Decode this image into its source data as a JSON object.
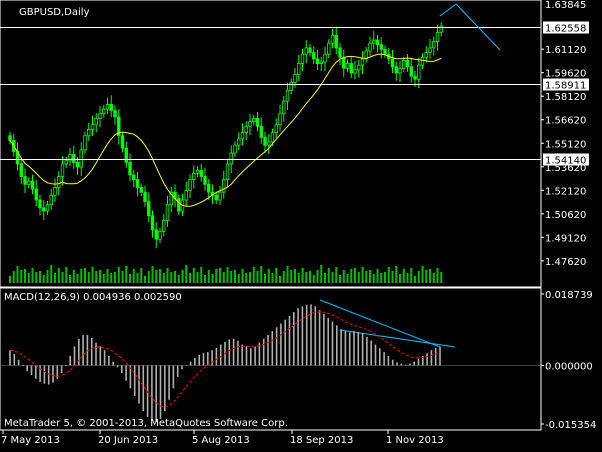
{
  "chart": {
    "symbol_label": "GBPUSD,Daily",
    "macd_label": "MACD(12,26,9) 0.004936 0.002590",
    "copyright": "MetaTrader 5, © 2001-2013, MetaQuotes Software Corp.",
    "price_axis": {
      "top_label": "1.63845",
      "labels": [
        "1.61120",
        "1.59620",
        "1.58120",
        "1.56620",
        "1.55120",
        "1.53620",
        "1.52120",
        "1.50620",
        "1.49120",
        "1.47620"
      ],
      "range": [
        1.464,
        1.64
      ]
    },
    "hlines": [
      {
        "price": "1.62558",
        "value": 1.62558,
        "boxed": true
      },
      {
        "price": "1.58911",
        "value": 1.58911,
        "boxed": true
      },
      {
        "price": "1.54140",
        "value": 1.5414,
        "boxed": true
      }
    ],
    "macd_axis": {
      "labels": [
        "0.018739",
        "0.000000",
        "-0.015354"
      ],
      "range": [
        -0.015354,
        0.018739
      ]
    },
    "date_labels": [
      "7 May 2013",
      "20 Jun 2013",
      "5 Aug 2013",
      "18 Sep 2013",
      "1 Nov 2013"
    ],
    "colors": {
      "background": "#000000",
      "grid": "#ffffff",
      "bull": "#00ff00",
      "bear": "#00ff00",
      "ma": "#ffff00",
      "trendline": "#00bfff",
      "histogram": "#b0b0b0",
      "signal": "#ff0000",
      "volume": "#00c000"
    }
  },
  "chart_data": {
    "type": "candlestick",
    "title": "GBPUSD,Daily",
    "indicators": [
      "Moving Average",
      "Volume",
      "MACD(12,26,9)"
    ],
    "ylim": [
      1.464,
      1.64
    ],
    "macd_ylim": [
      -0.015354,
      0.018739
    ],
    "close": [
      1.553,
      1.546,
      1.538,
      1.53,
      1.525,
      1.527,
      1.522,
      1.515,
      1.51,
      1.508,
      1.512,
      1.518,
      1.523,
      1.53,
      1.538,
      1.54,
      1.544,
      1.539,
      1.536,
      1.547,
      1.556,
      1.56,
      1.563,
      1.567,
      1.57,
      1.573,
      1.576,
      1.572,
      1.568,
      1.556,
      1.548,
      1.539,
      1.531,
      1.528,
      1.523,
      1.52,
      1.514,
      1.505,
      1.496,
      1.49,
      1.495,
      1.502,
      1.512,
      1.52,
      1.516,
      1.508,
      1.515,
      1.521,
      1.528,
      1.532,
      1.534,
      1.53,
      1.525,
      1.52,
      1.518,
      1.515,
      1.52,
      1.528,
      1.538,
      1.545,
      1.55,
      1.554,
      1.558,
      1.562,
      1.565,
      1.567,
      1.562,
      1.555,
      1.55,
      1.552,
      1.558,
      1.563,
      1.57,
      1.578,
      1.585,
      1.59,
      1.595,
      1.602,
      1.608,
      1.612,
      1.609,
      1.605,
      1.602,
      1.603,
      1.608,
      1.615,
      1.62,
      1.612,
      1.606,
      1.599,
      1.602,
      1.596,
      1.598,
      1.601,
      1.605,
      1.61,
      1.615,
      1.617,
      1.614,
      1.611,
      1.608,
      1.605,
      1.6,
      1.596,
      1.599,
      1.604,
      1.6,
      1.594,
      1.592,
      1.601,
      1.606,
      1.609,
      1.612,
      1.616,
      1.622,
      1.626
    ],
    "macd_histogram": [
      0.004,
      0.003,
      0.0015,
      0.0,
      -0.0015,
      -0.0025,
      -0.0035,
      -0.0043,
      -0.0048,
      -0.005,
      -0.0045,
      -0.0035,
      -0.002,
      0.0,
      0.0025,
      0.005,
      0.007,
      0.008,
      0.008,
      0.0072,
      0.006,
      0.005,
      0.004,
      0.0025,
      0.001,
      -0.0005,
      -0.002,
      -0.004,
      -0.006,
      -0.008,
      -0.01,
      -0.012,
      -0.0135,
      -0.0145,
      -0.0148,
      -0.014,
      -0.012,
      -0.009,
      -0.006,
      -0.003,
      -0.001,
      0.0,
      0.001,
      0.002,
      0.0028,
      0.0032,
      0.0035,
      0.004,
      0.0046,
      0.0055,
      0.0062,
      0.0068,
      0.007,
      0.0065,
      0.0055,
      0.005,
      0.0045,
      0.005,
      0.006,
      0.007,
      0.008,
      0.009,
      0.01,
      0.011,
      0.012,
      0.013,
      0.014,
      0.015,
      0.0155,
      0.0158,
      0.016,
      0.0155,
      0.0145,
      0.0135,
      0.0125,
      0.0115,
      0.0105,
      0.0095,
      0.009,
      0.0087,
      0.009,
      0.0088,
      0.0085,
      0.0075,
      0.0065,
      0.0055,
      0.0045,
      0.0035,
      0.0025,
      0.0015,
      0.0008,
      0.0005,
      0.0002,
      0.0005,
      0.001,
      0.0018,
      0.0025,
      0.0032,
      0.004,
      0.0046,
      0.0049
    ]
  }
}
